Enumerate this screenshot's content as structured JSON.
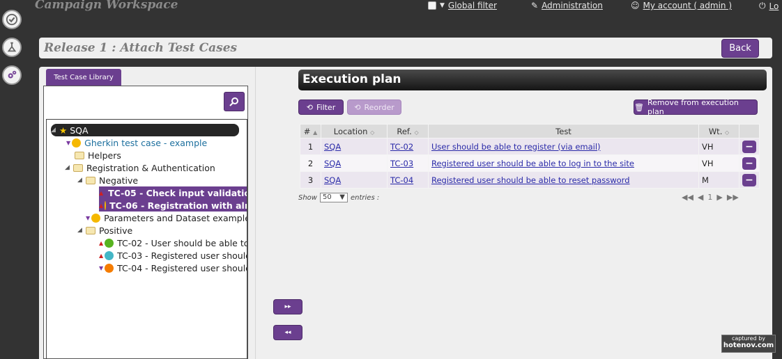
{
  "app": {
    "title": "Campaign Workspace"
  },
  "topnav": {
    "global_filter": "Global filter",
    "administration": "Administration",
    "my_account": "My account  ( admin )",
    "logout": "Lo"
  },
  "header": {
    "title": "Release 1  : Attach Test Cases",
    "back_label": "Back"
  },
  "library": {
    "tab_label": "Test Case Library",
    "tree": [
      {
        "label": "SQA",
        "kind": "root"
      },
      {
        "label": "Gherkin test case - example",
        "kind": "tc",
        "color": "#f5b800"
      },
      {
        "label": "Helpers",
        "kind": "folder"
      },
      {
        "label": "Registration & Authentication",
        "kind": "folder"
      },
      {
        "label": "Negative",
        "kind": "folder"
      },
      {
        "label": "TC-05 - Check input validatio",
        "kind": "tc-selected",
        "color": "#f5b800"
      },
      {
        "label": "TC-06 - Registration with alr",
        "kind": "tc-selected",
        "color": "#f5b800"
      },
      {
        "label": "Parameters and Dataset example",
        "kind": "tc",
        "color": "#f5b800"
      },
      {
        "label": "Positive",
        "kind": "folder"
      },
      {
        "label": "TC-02 - User should be able to",
        "kind": "tc",
        "color": "#58b320"
      },
      {
        "label": "TC-03 - Registered user should",
        "kind": "tc",
        "color": "#44b6c6"
      },
      {
        "label": "TC-04 - Registered user should",
        "kind": "tc",
        "color": "#f57c00"
      }
    ]
  },
  "plan": {
    "title": "Execution plan",
    "filter_label": "Filter",
    "reorder_label": "Reorder",
    "remove_label": "Remove from execution plan",
    "columns": [
      "#",
      "Location",
      "Ref.",
      "Test",
      "Wt.",
      ""
    ],
    "rows": [
      {
        "num": "1",
        "location": "SQA",
        "ref": "TC-02",
        "test": "User should be able to register (via email)",
        "weight": "VH"
      },
      {
        "num": "2",
        "location": "SQA",
        "ref": "TC-03",
        "test": "Registered user should be able to log in to the site",
        "weight": "VH"
      },
      {
        "num": "3",
        "location": "SQA",
        "ref": "TC-04",
        "test": "Registered user should be able to reset password",
        "weight": "M"
      }
    ],
    "show_label": "Show",
    "page_size": "50",
    "entries_label": "entries :",
    "pager": {
      "first": "◀◀",
      "prev": "◀",
      "page": "1",
      "next": "▶",
      "last": "▶▶"
    }
  },
  "move": {
    "add": "▸▸",
    "remove": "◂◂"
  },
  "watermark": {
    "line1": "captured by",
    "line2": "hotenov.com"
  }
}
